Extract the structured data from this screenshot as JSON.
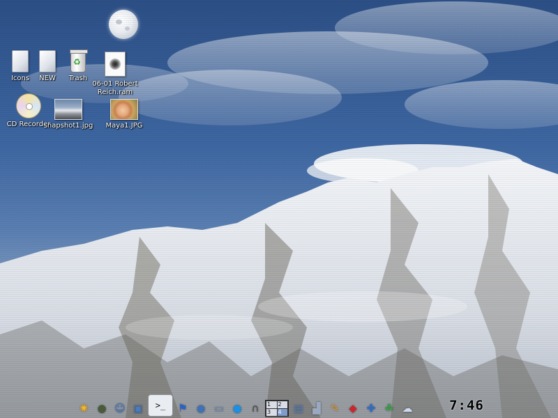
{
  "desktop_icons": {
    "icons": {
      "label": "Icons",
      "icon": "folder-icon"
    },
    "new": {
      "label": "NEW",
      "icon": "folder-icon"
    },
    "trash": {
      "label": "Trash",
      "icon": "trash-icon"
    },
    "ram_file": {
      "label_line1": "06-01 Robert",
      "label_line2": "Reich.ram",
      "icon": "audio-file-icon"
    },
    "cd_recorder": {
      "label": "CD Recorder",
      "icon": "cd-icon"
    },
    "snapshot": {
      "label": "snapshot1.jpg",
      "icon": "image-thumbnail-icon"
    },
    "maya": {
      "label": "Maya1.JPG",
      "icon": "image-thumbnail-icon"
    }
  },
  "dock": {
    "launchers": [
      {
        "name": "kde-menu-icon",
        "glyph": "✺",
        "color": "#f2b531"
      },
      {
        "name": "turtle-icon",
        "glyph": "●",
        "color": "#4a5a3a"
      },
      {
        "name": "finder-icon",
        "glyph": "☺",
        "color": "#3d74c9"
      },
      {
        "name": "monitor-icon",
        "glyph": "▣",
        "color": "#4a7bbf"
      },
      {
        "name": "terminal-icon",
        "glyph": ">_",
        "color": "#111111"
      },
      {
        "name": "runner-icon",
        "glyph": "⚑",
        "color": "#2a63c7"
      },
      {
        "name": "browser-icon",
        "glyph": "◉",
        "color": "#3473c9"
      },
      {
        "name": "laptop-icon",
        "glyph": "▭",
        "color": "#6f8fbf"
      },
      {
        "name": "ie-icon",
        "glyph": "●",
        "color": "#1d8fe0"
      },
      {
        "name": "headphones-icon",
        "glyph": "∩",
        "color": "#4d4d4d"
      }
    ],
    "pager": {
      "desktops": [
        "1",
        "2",
        "3",
        "4"
      ],
      "current": "4"
    },
    "tray": [
      {
        "name": "files-icon",
        "glyph": "▤",
        "color": "#5c86c6"
      },
      {
        "name": "printer-icon",
        "glyph": "▟",
        "color": "#9aa9c0"
      },
      {
        "name": "notes-icon",
        "glyph": "✎",
        "color": "#e3a33b"
      },
      {
        "name": "flash-icon",
        "glyph": "◆",
        "color": "#c9272d"
      },
      {
        "name": "network-icon",
        "glyph": "✤",
        "color": "#2c6fd0"
      },
      {
        "name": "frog-icon",
        "glyph": "☘",
        "color": "#3aa048"
      },
      {
        "name": "chat-icon",
        "glyph": "☁",
        "color": "#cfdbf0"
      }
    ],
    "clock": "7:46"
  },
  "colors": {
    "sky": "#3e67a2",
    "snow": "#eef1f5",
    "rock": "#6b6a62"
  }
}
